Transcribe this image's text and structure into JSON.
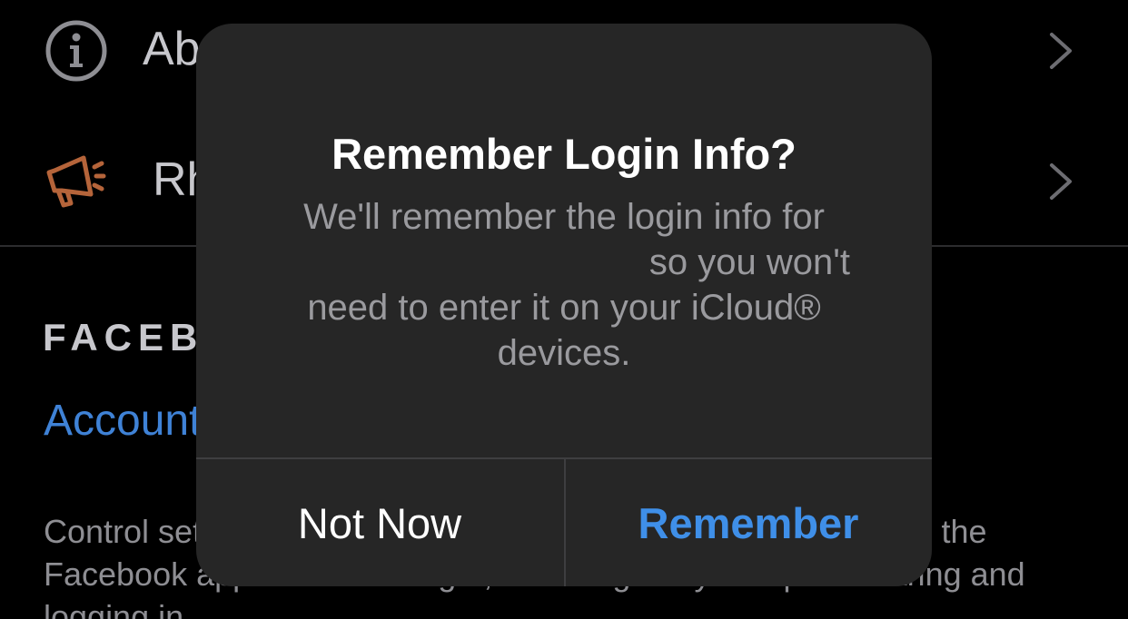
{
  "settings": {
    "about": {
      "label": "About",
      "icon": "info-circle-icon"
    },
    "rh": {
      "label": "Rh",
      "icon": "megaphone-icon"
    },
    "section_header": "FACEBOOK",
    "account_link": "Accounts Center",
    "footer_description": "Control settings for connected experiences across Instagram, the Facebook app and Messenger, including story and post sharing and logging in."
  },
  "alert": {
    "title": "Remember Login Info?",
    "message_line1": "We'll remember the login info for",
    "message_line2": "so you won't",
    "message_line3": "need to enter it on your iCloud®",
    "message_line4": "devices.",
    "not_now_label": "Not Now",
    "remember_label": "Remember"
  },
  "colors": {
    "background": "#000000",
    "alert_background": "#262626",
    "accent_blue": "#3f8fe8",
    "link_blue": "#3f82d6",
    "megaphone_orange": "#b5643a"
  }
}
